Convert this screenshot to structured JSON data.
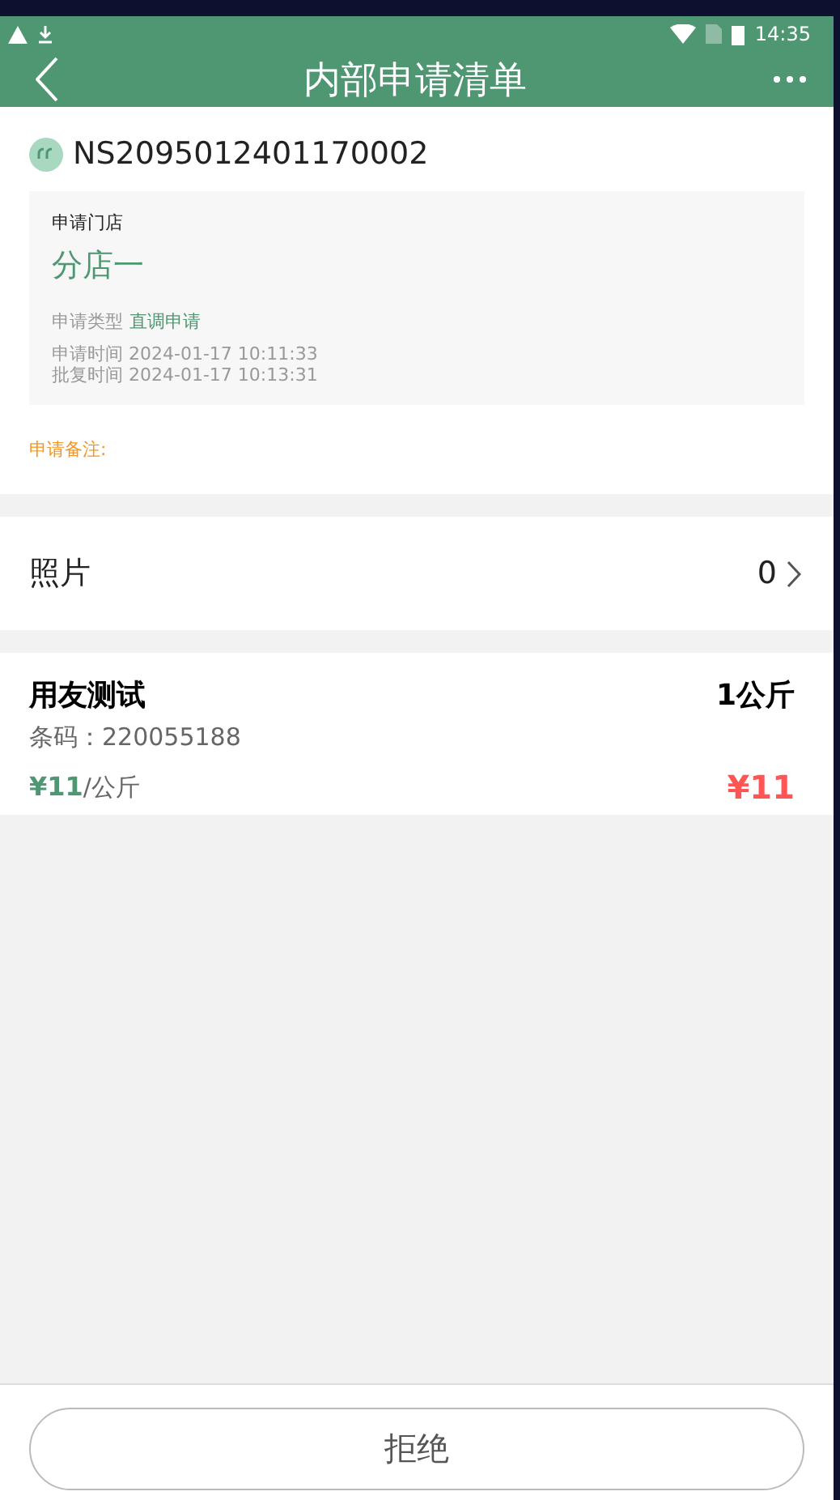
{
  "status_bar": {
    "time": "14:35"
  },
  "header": {
    "title": "内部申请清单"
  },
  "order": {
    "number": "NS2095012401170002",
    "store_label": "申请门店",
    "store": "分店一",
    "type_label": "申请类型",
    "type": "直调申请",
    "times": [
      {
        "label": "申请时间",
        "value": "2024-01-17 10:11:33"
      },
      {
        "label": "批复时间",
        "value": "2024-01-17 10:13:31"
      }
    ],
    "remark_label": "申请备注:"
  },
  "photos": {
    "label": "照片",
    "count": "0"
  },
  "items": [
    {
      "name": "用友测试",
      "quantity": "1公斤",
      "barcode": "条码：220055188",
      "price": "¥11",
      "unit": "/公斤",
      "total": "¥11"
    }
  ],
  "footer": {
    "button": "拒绝"
  }
}
